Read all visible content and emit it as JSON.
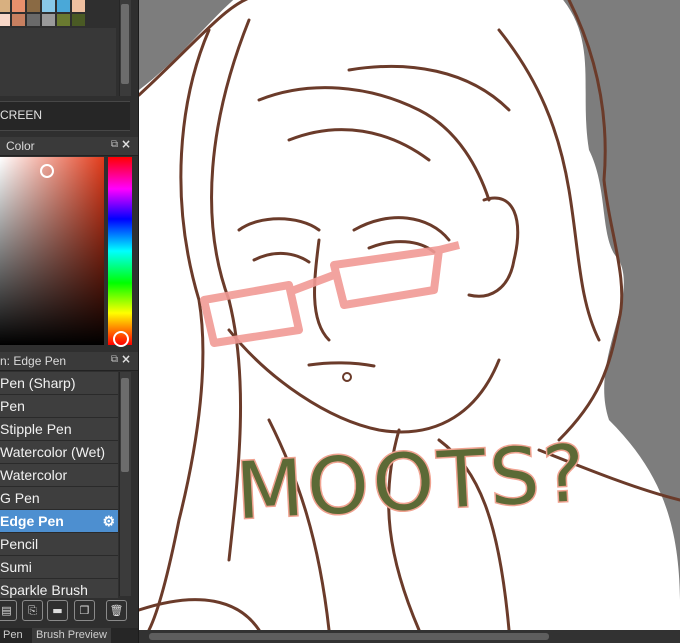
{
  "swatch_colors": [
    "#d8b080",
    "#e8906c",
    "#8a6a44",
    "#88c8e8",
    "#4aa8d8",
    "#f0c0a0",
    "#f8d8c8",
    "#c88060",
    "#6a6a6a",
    "#9a9a9a",
    "#6a7a30",
    "#4a5a24"
  ],
  "blend_mode": {
    "label": "CREEN"
  },
  "color_panel": {
    "title": "Color"
  },
  "brush_panel": {
    "title": "n: Edge Pen",
    "items": [
      {
        "label": "Pen (Sharp)"
      },
      {
        "label": "Pen"
      },
      {
        "label": "Stipple Pen"
      },
      {
        "label": "Watercolor (Wet)"
      },
      {
        "label": "Watercolor"
      },
      {
        "label": "G Pen"
      },
      {
        "label": "Edge Pen",
        "selected": true
      },
      {
        "label": "Pencil"
      },
      {
        "label": "Sumi"
      },
      {
        "label": "Sparkle Brush"
      }
    ]
  },
  "tabs": [
    {
      "label": "Pen"
    },
    {
      "label": "Brush Preview"
    }
  ],
  "canvas": {
    "text": "MOOTS?",
    "text_color": "#5c6a36",
    "outline_color": "#f0a290",
    "glasses_color": "#f19a95",
    "line_color": "#6b3b2a"
  }
}
